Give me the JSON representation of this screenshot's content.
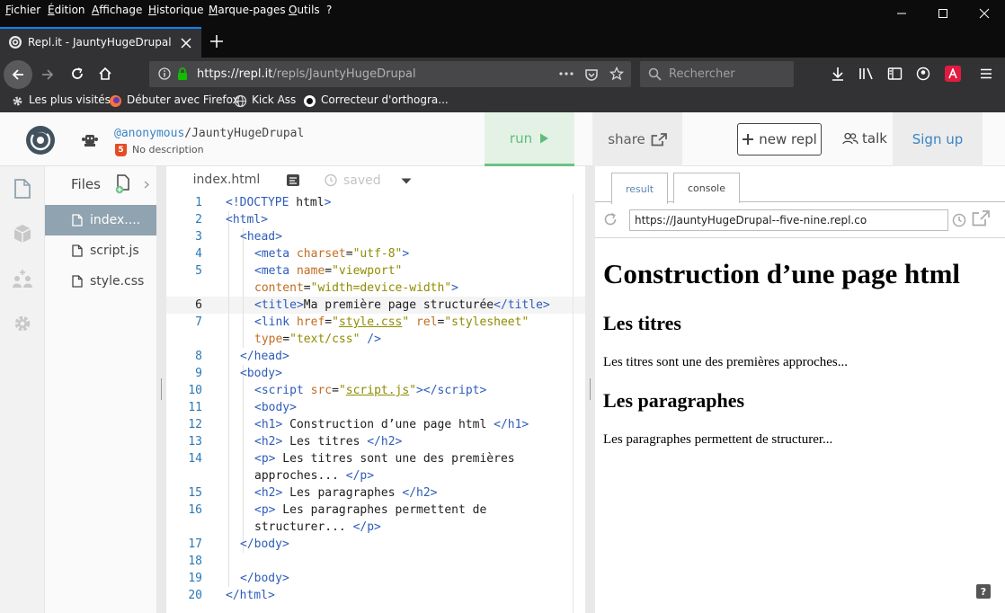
{
  "firefox": {
    "menu": [
      "Fichier",
      "Édition",
      "Affichage",
      "Historique",
      "Marque-pages",
      "Outils",
      "?"
    ],
    "tab_title": "Repl.it - JauntyHugeDrupal",
    "url_host": "https://repl.it",
    "url_path": "/repls/JauntyHugeDrupal",
    "search_placeholder": "Rechercher",
    "bookmarks": [
      "Les plus visités",
      "Débuter avec Firefox",
      "Kick Ass",
      "Correcteur d'orthogra..."
    ]
  },
  "repl": {
    "owner": "@anonymous",
    "separator": "/",
    "name": "JauntyHugeDrupal",
    "description": "No description",
    "run_label": "run",
    "share_label": "share",
    "new_repl_label": "new repl",
    "talk_label": "talk",
    "signup_label": "Sign up"
  },
  "files": {
    "header": "Files",
    "items": [
      "index....",
      "script.js",
      "style.css"
    ],
    "active_index": 0
  },
  "editor": {
    "tab": "index.html",
    "save_status": "saved",
    "line_numbers": [
      "1",
      "2",
      "3",
      "4",
      "5",
      "",
      "6",
      "7",
      "",
      "8",
      "9",
      "10",
      "11",
      "12",
      "13",
      "14",
      "",
      "15",
      "16",
      "",
      "17",
      "18",
      "19",
      "20"
    ]
  },
  "result": {
    "tabs": [
      "result",
      "console"
    ],
    "active_tab": 0,
    "url": "https://JauntyHugeDrupal--five-nine.repl.co",
    "h1": "Construction d’une page html",
    "h2a": "Les titres",
    "p1": "Les titres sont une des premières approches...",
    "h2b": "Les paragraphes",
    "p2": "Les paragraphes permettent de structurer...",
    "help": "?"
  },
  "colors": {
    "run_green": "#5fbd79",
    "signup_blue": "#3a84c6",
    "active_file": "#8fa3b0",
    "tag_blue": "#2e5cba",
    "attr_orange": "#c26c22",
    "string_olive": "#8f8c00"
  }
}
